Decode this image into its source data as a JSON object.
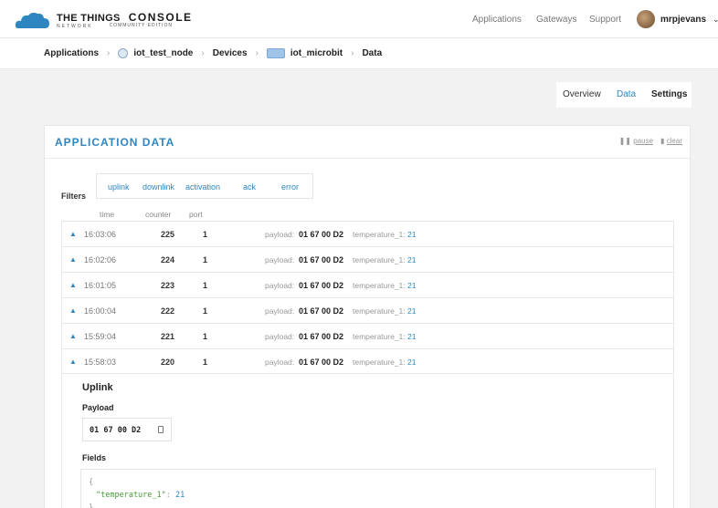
{
  "brand": {
    "name": "THE THINGS",
    "network": "NETWORK",
    "product": "CONSOLE",
    "edition": "COMMUNITY EDITION"
  },
  "nav": {
    "applications": "Applications",
    "gateways": "Gateways",
    "support": "Support",
    "user": "mrpjevans"
  },
  "breadcrumb": {
    "applications": "Applications",
    "app": "iot_test_node",
    "devices": "Devices",
    "device": "iot_microbit",
    "data": "Data"
  },
  "tabs": {
    "overview": "Overview",
    "data": "Data",
    "settings": "Settings"
  },
  "panel": {
    "title": "APPLICATION DATA",
    "pause": "pause",
    "clear": "clear"
  },
  "filters": {
    "label": "Filters",
    "uplink": "uplink",
    "downlink": "downlink",
    "activation": "activation",
    "ack": "ack",
    "error": "error"
  },
  "columns": {
    "time": "time",
    "counter": "counter",
    "port": "port"
  },
  "rows": [
    {
      "time": "16:03:06",
      "counter": "225",
      "port": "1",
      "payload_label": "payload:",
      "payload": "01 67 00 D2",
      "field": "temperature_1:",
      "value": "21"
    },
    {
      "time": "16:02:06",
      "counter": "224",
      "port": "1",
      "payload_label": "payload:",
      "payload": "01 67 00 D2",
      "field": "temperature_1:",
      "value": "21"
    },
    {
      "time": "16:01:05",
      "counter": "223",
      "port": "1",
      "payload_label": "payload:",
      "payload": "01 67 00 D2",
      "field": "temperature_1:",
      "value": "21"
    },
    {
      "time": "16:00:04",
      "counter": "222",
      "port": "1",
      "payload_label": "payload:",
      "payload": "01 67 00 D2",
      "field": "temperature_1:",
      "value": "21"
    },
    {
      "time": "15:59:04",
      "counter": "221",
      "port": "1",
      "payload_label": "payload:",
      "payload": "01 67 00 D2",
      "field": "temperature_1:",
      "value": "21"
    },
    {
      "time": "15:58:03",
      "counter": "220",
      "port": "1",
      "payload_label": "payload:",
      "payload": "01 67 00 D2",
      "field": "temperature_1:",
      "value": "21"
    }
  ],
  "detail": {
    "title": "Uplink",
    "payload_title": "Payload",
    "payload_hex": "01 67 00 D2",
    "fields_title": "Fields",
    "json_open": "{",
    "json_key": "\"temperature_1\"",
    "json_colon": ": ",
    "json_value": "21",
    "json_close": "}"
  },
  "icons": {
    "logo": "cloud-logo-icon",
    "expand": "triangle-up-icon",
    "copy": "copy-icon",
    "pause": "pause-icon",
    "clear": "trash-icon"
  },
  "colors": {
    "accent": "#2e86c1",
    "json_key": "#4b9a3c"
  }
}
